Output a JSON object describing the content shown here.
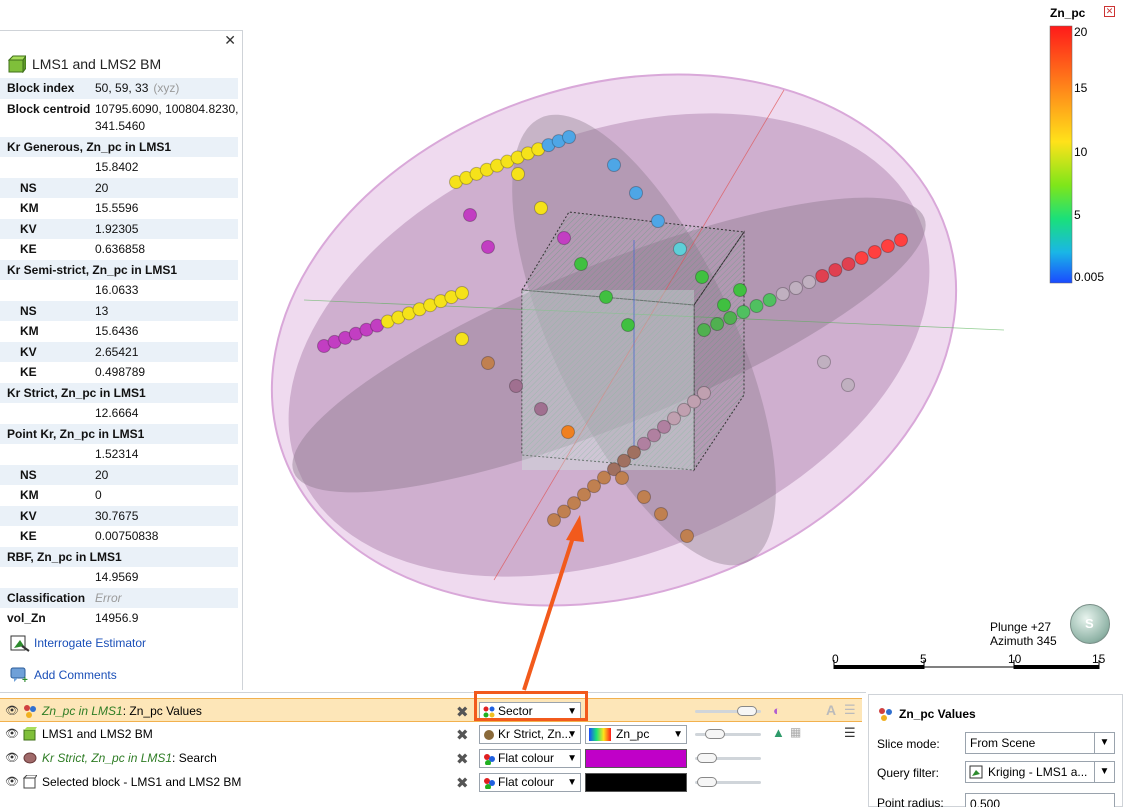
{
  "info_panel": {
    "close_label": "✕",
    "title": "LMS1 and LMS2 BM",
    "rows": [
      {
        "label": "Block index",
        "value": "50, 59, 33",
        "suffix": "(xyz)"
      },
      {
        "label": "Block centroid",
        "value": "10795.6090, 100804.8230,",
        "value2": "341.5460"
      },
      {
        "label": "Kr Generous, Zn_pc in LMS1",
        "value": ""
      },
      {
        "label": "",
        "value": "15.8402"
      },
      {
        "label": "NS",
        "value": "20"
      },
      {
        "label": "KM",
        "value": "15.5596"
      },
      {
        "label": "KV",
        "value": "1.92305"
      },
      {
        "label": "KE",
        "value": "0.636858"
      },
      {
        "label": "Kr Semi-strict, Zn_pc in LMS1",
        "value": ""
      },
      {
        "label": "",
        "value": "16.0633"
      },
      {
        "label": "NS",
        "value": "13"
      },
      {
        "label": "KM",
        "value": "15.6436"
      },
      {
        "label": "KV",
        "value": "2.65421"
      },
      {
        "label": "KE",
        "value": "0.498789"
      },
      {
        "label": "Kr Strict, Zn_pc in LMS1",
        "value": ""
      },
      {
        "label": "",
        "value": "12.6664"
      },
      {
        "label": "Point Kr, Zn_pc in LMS1",
        "value": ""
      },
      {
        "label": "",
        "value": "1.52314"
      },
      {
        "label": "NS",
        "value": "20"
      },
      {
        "label": "KM",
        "value": "0"
      },
      {
        "label": "KV",
        "value": "30.7675"
      },
      {
        "label": "KE",
        "value": "0.00750838"
      },
      {
        "label": "RBF, Zn_pc in LMS1",
        "value": ""
      },
      {
        "label": "",
        "value": "14.9569"
      },
      {
        "label": "Classification",
        "value": "Error"
      },
      {
        "label": "vol_Zn",
        "value": "14956.9"
      }
    ],
    "interrogate_label": "Interrogate Estimator",
    "comments_label": "Add Comments"
  },
  "scene": {
    "legend": {
      "title": "Zn_pc",
      "ticks": [
        "20",
        "15",
        "10",
        "5",
        "0.005"
      ],
      "close_label": "✕"
    },
    "plunge": "Plunge +27",
    "azimuth": "Azimuth 345",
    "compass_letter": "S",
    "scale_labels": [
      "0",
      "5",
      "10",
      "15"
    ]
  },
  "layers": [
    {
      "name_italic": "Zn_pc in LMS1",
      "name_rest": ": Zn_pc Values",
      "combo": "Sector",
      "selected": true
    },
    {
      "name_italic": "",
      "name_rest": "LMS1 and LMS2 BM",
      "combo": "Kr Strict, Zn...",
      "swatch_label": "Zn_pc",
      "selected": false
    },
    {
      "name_italic": "Kr Strict, Zn_pc in LMS1",
      "name_rest": ": Search",
      "combo": "Flat colour",
      "swatch_color": "#c000c8",
      "selected": false
    },
    {
      "name_italic": "",
      "name_rest": "Selected block - LMS1 and LMS2 BM",
      "combo": "Flat colour",
      "swatch_color": "#000000",
      "selected": false
    }
  ],
  "properties": {
    "title": "Zn_pc Values",
    "slice_mode_label": "Slice mode:",
    "slice_mode_value": "From Scene",
    "query_filter_label": "Query filter:",
    "query_filter_value": "Kriging - LMS1 a...",
    "point_radius_label": "Point radius:",
    "point_radius_value": "0.500"
  },
  "colors": {
    "accent_orange": "#f25a1c",
    "selected_row": "#fde6b8",
    "search_ellipsoid": "#c000c8"
  }
}
